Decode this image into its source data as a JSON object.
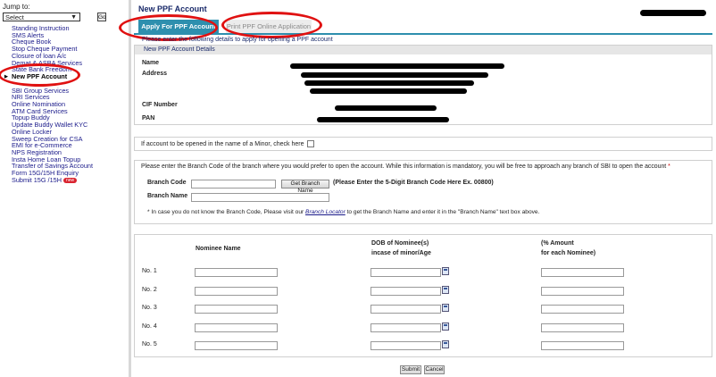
{
  "sidebar": {
    "jump_label": "Jump to:",
    "select_value": "Select",
    "go_label": "Go",
    "items": [
      "Standing Instruction",
      "SMS Alerts",
      "Cheque Book",
      "Stop Cheque Payment",
      "Closure of loan A/c",
      "Demat & ASBA Services",
      "State Bank Freedom",
      "New PPF Account",
      "SBI Group Services",
      "NRI Services",
      "Online Nomination",
      "ATM Card Services",
      "Topup Buddy",
      "Update Buddy Wallet KYC",
      "Online Locker",
      "Sweep Creation for CSA",
      "EMI for e-Commerce",
      "NPS Registration",
      "Insta Home Loan Topup",
      "Transfer of Savings Account",
      "Form 15G/15H Enquiry",
      "Submit 15G /15H"
    ],
    "new_badge": "new"
  },
  "header": {
    "page_title": "New PPF Account",
    "tabs": [
      "Apply For PPF Account",
      "Print PPF Online Application"
    ]
  },
  "details": {
    "intro": "Please enter the following details to apply for opening a PPF account",
    "section_title": "New PPF Account Details",
    "name_label": "Name",
    "address_label": "Address",
    "cif_label": "CIF Number",
    "pan_label": "PAN"
  },
  "minor": {
    "question": "If account to be opened in the name of a Minor, check here"
  },
  "branch": {
    "intro": "Please enter the Branch Code of the branch where you would prefer to open the account. While this information is mandatory, you will be free to approach any branch of SBI to open the account",
    "required_mark": "*",
    "code_label": "Branch Code",
    "get_button": "Get Branch Name",
    "hint": "(Please Enter the 5-Digit Branch Code Here Ex. 00800)",
    "name_label": "Branch Name",
    "note_prefix": "* In case you do not know the Branch Code, Please visit our ",
    "locator_link": "Branch Locator",
    "note_suffix": " to get the Branch Name and enter it in the \"Branch Name\" text box above."
  },
  "nominee": {
    "col_name": "Nominee Name",
    "col_dob_1": "DOB of Nominee(s)",
    "col_dob_2": "incase of minor/Age",
    "col_amt_1": "(% Amount",
    "col_amt_2": "for each Nominee)",
    "rows": [
      "No. 1",
      "No. 2",
      "No. 3",
      "No. 4",
      "No. 5"
    ]
  },
  "actions": {
    "submit": "Submit",
    "cancel": "Cancel"
  },
  "colors": {
    "active_tab": "#2e8fae",
    "annotation": "#e01111",
    "link": "#1a1a8a"
  }
}
